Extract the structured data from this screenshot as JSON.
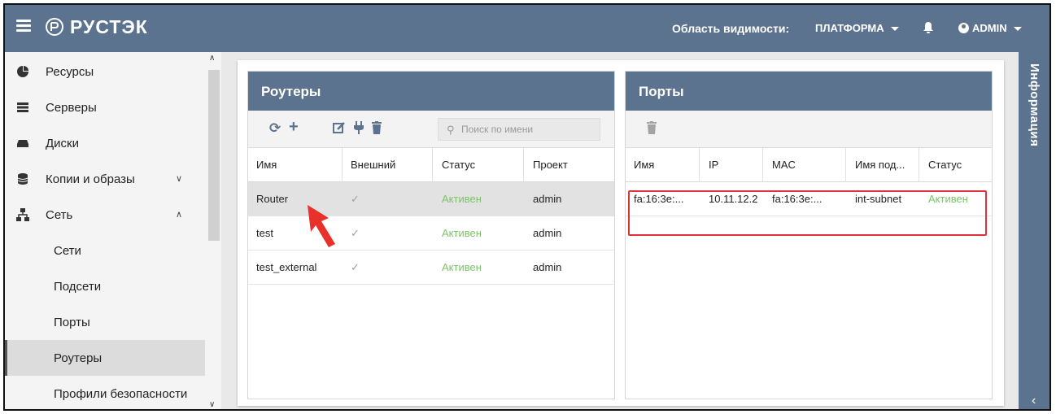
{
  "header": {
    "brand": "РУСТЭК",
    "scope_label": "Область видимости:",
    "scope_value": "ПЛАТФОРМА",
    "user": "ADMIN"
  },
  "sidebar": {
    "items": [
      {
        "label": "Ресурсы",
        "icon": "pie-chart-icon"
      },
      {
        "label": "Серверы",
        "icon": "server-icon"
      },
      {
        "label": "Диски",
        "icon": "drive-icon"
      },
      {
        "label": "Копии и образы",
        "icon": "database-icon"
      },
      {
        "label": "Сеть",
        "icon": "network-icon"
      }
    ],
    "subitems": [
      {
        "label": "Сети"
      },
      {
        "label": "Подсети"
      },
      {
        "label": "Порты"
      },
      {
        "label": "Роутеры",
        "active": true
      },
      {
        "label": "Профили безопасности"
      }
    ]
  },
  "routers": {
    "title": "Роутеры",
    "search_placeholder": "Поиск по имени",
    "columns": [
      "Имя",
      "Внешний",
      "Статус",
      "Проект"
    ],
    "rows": [
      {
        "name": "Router",
        "external": "✓",
        "status": "Активен",
        "project": "admin"
      },
      {
        "name": "test",
        "external": "✓",
        "status": "Активен",
        "project": "admin"
      },
      {
        "name": "test_external",
        "external": "✓",
        "status": "Активен",
        "project": "admin"
      }
    ]
  },
  "ports": {
    "title": "Порты",
    "columns": [
      "Имя",
      "IP",
      "MAC",
      "Имя под...",
      "Статус"
    ],
    "rows": [
      {
        "name": "fa:16:3e:...",
        "ip": "10.11.12.2",
        "mac": "fa:16:3e:...",
        "subnet": "int-subnet",
        "status": "Активен"
      }
    ]
  },
  "info_panel": {
    "label": "Информация"
  },
  "colors": {
    "primary": "#5c7390",
    "status_active": "#7ec26b",
    "highlight": "#e0303a"
  }
}
